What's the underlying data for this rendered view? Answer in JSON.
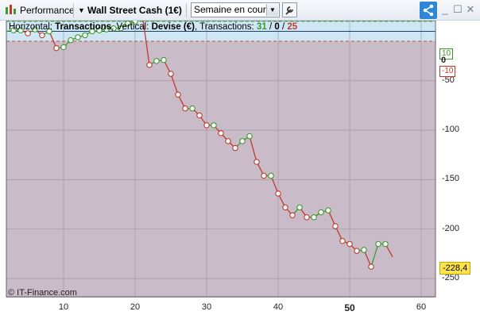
{
  "toolbar": {
    "performance_label": "Performance",
    "instrument_label": "Wall Street Cash (1€)",
    "period_value": "Semaine en cours"
  },
  "chart_header": {
    "prefix": "Horizontal: ",
    "h_axis": "Transactions",
    "mid": ", Vertical: ",
    "v_axis": "Devise (€)",
    "tx_prefix": ", Transactions: ",
    "tx_win": "31",
    "tx_sep1": " / ",
    "tx_zero": "0",
    "tx_sep2": " / ",
    "tx_loss": "25"
  },
  "bands": {
    "upper_label": "10",
    "lower_label": "-10",
    "zero_label": "0"
  },
  "last_value": "-228,4",
  "watermark": "© IT-Finance.com",
  "colors": {
    "gain": "#3a9a2a",
    "loss": "#c0392b",
    "positive_band": "#a8e3c0",
    "neutral_band": "#cfe6f4",
    "negative_bg": "#cabbc8"
  },
  "chart_data": {
    "type": "line",
    "xlabel": "Transactions",
    "ylabel": "Devise (€)",
    "xlim": [
      2,
      62
    ],
    "ylim": [
      -270,
      10
    ],
    "x_ticks": [
      10,
      20,
      30,
      40,
      50,
      60
    ],
    "y_ticks": [
      -50,
      -100,
      -150,
      -200,
      -250
    ],
    "band": [
      -10,
      10
    ],
    "x": [
      2,
      3,
      4,
      5,
      6,
      7,
      8,
      9,
      10,
      11,
      12,
      13,
      14,
      15,
      16,
      17,
      18,
      19,
      20,
      21,
      22,
      23,
      24,
      25,
      26,
      27,
      28,
      29,
      30,
      31,
      32,
      33,
      34,
      35,
      36,
      37,
      38,
      39,
      40,
      41,
      42,
      43,
      44,
      45,
      46,
      47,
      48,
      49,
      50,
      51,
      52,
      53,
      54,
      55,
      56
    ],
    "y": [
      0,
      1,
      1,
      -2,
      2,
      -4,
      0,
      -17,
      -16,
      -9,
      -6,
      -4,
      0,
      1,
      2,
      3,
      3,
      8,
      10,
      17,
      -34,
      -30,
      -29,
      -43,
      -64,
      -78,
      -78,
      -85,
      -95,
      -95,
      -103,
      -111,
      -118,
      -111,
      -106,
      -132,
      -146,
      -146,
      -164,
      -178,
      -186,
      -178,
      -188,
      -188,
      -183,
      -181,
      -197,
      -212,
      -215,
      -222,
      -221,
      -238,
      -215,
      -215,
      -228
    ]
  }
}
